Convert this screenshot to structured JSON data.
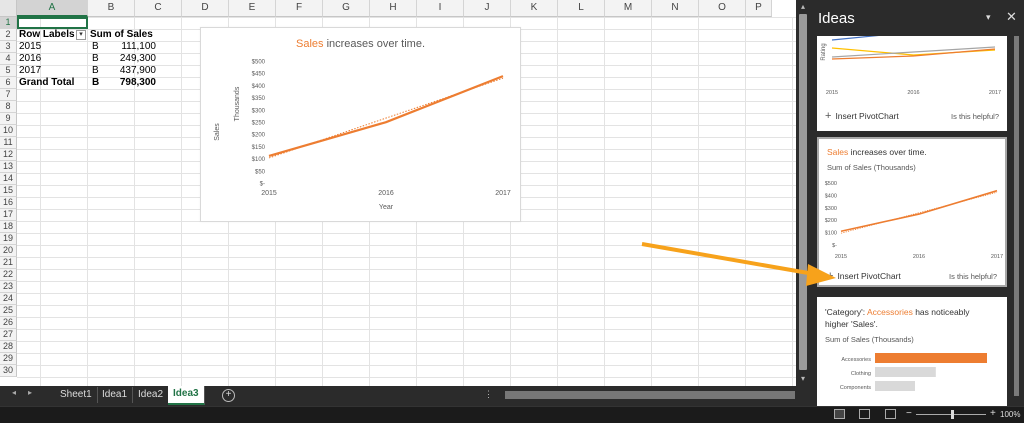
{
  "columns": [
    "A",
    "B",
    "C",
    "D",
    "E",
    "F",
    "G",
    "H",
    "I",
    "J",
    "K",
    "L",
    "M",
    "N",
    "O",
    "P"
  ],
  "rows": [
    "1",
    "2",
    "3",
    "4",
    "5",
    "6",
    "7",
    "8",
    "9",
    "10",
    "11",
    "12",
    "13",
    "14",
    "15",
    "16",
    "17",
    "18",
    "19",
    "20",
    "21",
    "22",
    "23",
    "24",
    "25",
    "26",
    "27",
    "28",
    "29",
    "30"
  ],
  "pivot": {
    "header": {
      "label": "Row Labels",
      "value": "Sum of Sales"
    },
    "rows": [
      {
        "label": "2015",
        "currency": "B",
        "value": "111,100"
      },
      {
        "label": "2016",
        "currency": "B",
        "value": "249,300"
      },
      {
        "label": "2017",
        "currency": "B",
        "value": "437,900"
      }
    ],
    "total": {
      "label": "Grand Total",
      "currency": "B",
      "value": "798,300"
    },
    "filter_glyph": "▾"
  },
  "main_chart": {
    "title_highlight": "Sales",
    "title_rest": " increases over time.",
    "ylabel_outer": "Sales",
    "ylabel_inner": "Thousands",
    "xlabel": "Year"
  },
  "chart_data": [
    {
      "type": "line",
      "title": "Sales increases over time.",
      "x": [
        "2015",
        "2016",
        "2017"
      ],
      "series": [
        {
          "values": [
            111.1,
            249.3,
            437.9
          ]
        }
      ],
      "yticks": [
        "$-",
        "$50",
        "$100",
        "$150",
        "$200",
        "$250",
        "$300",
        "$350",
        "$400",
        "$450",
        "$500"
      ],
      "ylim": [
        0,
        500
      ],
      "xlabel": "Year",
      "ylabel": "Sales",
      "units_label": "Thousands",
      "trendline": "dotted linear"
    },
    {
      "type": "line",
      "title": "Sales increases over time.",
      "subtitle": "Sum of Sales (Thousands)",
      "x": [
        "2015",
        "2016",
        "2017"
      ],
      "series": [
        {
          "values": [
            111.1,
            249.3,
            437.9
          ]
        }
      ],
      "yticks": [
        "$-",
        "$100",
        "$200",
        "$300",
        "$400",
        "$500"
      ],
      "ylim": [
        0,
        500
      ]
    },
    {
      "type": "bar",
      "title": "'Category': Accessories has noticeably higher 'Sales'.",
      "subtitle": "Sum of Sales (Thousands)",
      "categories": [
        "Accessories",
        "Clothing",
        "Components"
      ],
      "values": [
        700,
        380,
        250
      ],
      "highlight": "Accessories"
    }
  ],
  "tabs": {
    "items": [
      "Sheet1",
      "Idea1",
      "Idea2",
      "Idea3"
    ],
    "active": "Idea3",
    "add_glyph": "+",
    "nav_prev": "◂",
    "nav_next": "▸"
  },
  "ideas_pane": {
    "title": "Ideas",
    "menu_glyph": "▾",
    "close_glyph": "✕",
    "card1": {
      "ylabel": "Rating",
      "x": [
        "2015",
        "2016",
        "2017"
      ],
      "insert_label": "Insert PivotChart",
      "helpful_label": "Is this helpful?",
      "colors": [
        "#4472c4",
        "#ffc000",
        "#a5a5a5",
        "#ed7d31"
      ]
    },
    "card2": {
      "title_highlight": "Sales",
      "title_rest": " increases over time.",
      "subtitle": "Sum of Sales (Thousands)",
      "insert_label": "Insert PivotChart",
      "helpful_label": "Is this helpful?"
    },
    "card3": {
      "line1_prefix": "'Category': ",
      "line1_highlight": "Accessories",
      "line1_suffix": " has noticeably",
      "line2": "higher 'Sales'.",
      "subtitle": "Sum of Sales (Thousands)"
    }
  },
  "status": {
    "zoom": "100%",
    "zoom_minus": "−",
    "zoom_plus": "+"
  },
  "colors": {
    "accent_orange": "#ed7d31",
    "excel_green": "#217346",
    "annotation_arrow": "#f7a21b",
    "gray_bar": "#d9d9d9"
  }
}
